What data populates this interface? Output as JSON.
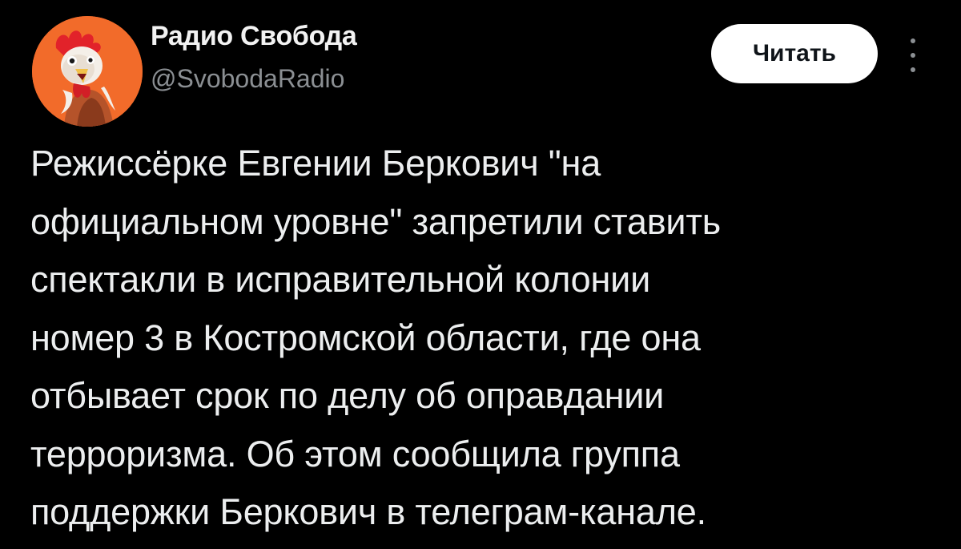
{
  "author": {
    "name": "Радио Свобода",
    "handle": "@SvobodaRadio",
    "avatar_icon": "rooster-avatar-icon",
    "avatar_color": "#f26b2a"
  },
  "actions": {
    "follow_label": "Читать",
    "more_icon": "more-vertical-icon"
  },
  "post": {
    "text": "Режиссёрке Евгении Беркович \"на\nофициальном уровне\" запретили ставить\nспектакли в исправительной колонии\nномер 3 в Костромской области, где она\nотбывает срок по делу об оправдании\nтерроризма. Об этом сообщила группа\nподдержки Беркович в телеграм-канале."
  },
  "colors": {
    "background": "#000000",
    "text": "#eceeef",
    "secondary_text": "#8b8f93",
    "button_bg": "#ffffff",
    "button_text": "#0f1419"
  }
}
